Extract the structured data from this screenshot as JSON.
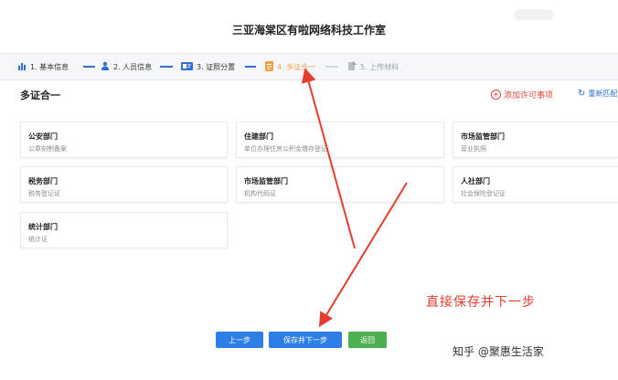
{
  "page": {
    "title": "三亚海棠区有啦网络科技工作室"
  },
  "steps": [
    {
      "label": "1. 基本信息",
      "icon": "bar-chart-icon",
      "state": "done"
    },
    {
      "label": "2. 人员信息",
      "icon": "person-icon",
      "state": "done"
    },
    {
      "label": "3. 证照分置",
      "icon": "id-card-icon",
      "state": "done"
    },
    {
      "label": "4. 多证合一",
      "icon": "document-icon",
      "state": "active"
    },
    {
      "label": "5. 上传材料",
      "icon": "upload-icon",
      "state": "disabled"
    }
  ],
  "section": {
    "title": "多证合一",
    "add_label": "添加许可事项",
    "reset_label": "重新匹配"
  },
  "cards": [
    {
      "dept": "公安部门",
      "item": "公章刻制备案"
    },
    {
      "dept": "住建部门",
      "item": "单位办理住房公积金缴存登记"
    },
    {
      "dept": "市场监管部门",
      "item": "营业执照"
    },
    {
      "dept": "税务部门",
      "item": "税务登记证"
    },
    {
      "dept": "市场监管部门",
      "item": "机构代码证"
    },
    {
      "dept": "人社部门",
      "item": "社会保险登记证"
    },
    {
      "dept": "统计部门",
      "item": "统计证"
    }
  ],
  "buttons": {
    "prev": "上一步",
    "save_next": "保存并下一步",
    "back": "返回"
  },
  "annotation": {
    "text": "直接保存并下一步"
  },
  "watermark": {
    "text": "知乎 @聚惠生活家"
  },
  "colors": {
    "primary": "#2f7ee6",
    "danger": "#e0483b",
    "success": "#4caf50",
    "active_step": "#f0a24a"
  }
}
